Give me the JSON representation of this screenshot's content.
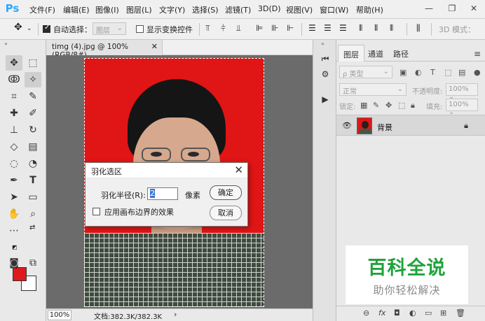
{
  "app": {
    "logo": "Ps"
  },
  "menu": [
    "文件(F)",
    "编辑(E)",
    "图像(I)",
    "图层(L)",
    "文字(Y)",
    "选择(S)",
    "滤镜(T)",
    "3D(D)",
    "视图(V)",
    "窗口(W)",
    "帮助(H)"
  ],
  "options": {
    "auto_select_label": "自动选择：",
    "auto_select_target": "图层",
    "show_transform_label": "显示变换控件",
    "mode_3d": "3D 模式："
  },
  "document": {
    "tab_title": "timg (4).jpg @ 100%(RGB/8#)",
    "zoom": "100%",
    "doc_info": "文档:382.3K/382.3K"
  },
  "colors": {
    "foreground": "#df1a1a",
    "background": "#ffffff",
    "canvas_bg": "#e01515"
  },
  "dialog": {
    "title": "羽化选区",
    "radius_label": "羽化半径(R):",
    "radius_value": "2",
    "unit": "像素",
    "edge_checkbox_label": "应用画布边界的效果",
    "edge_checked": false,
    "ok_label": "确定",
    "cancel_label": "取消"
  },
  "layers_panel": {
    "tabs": [
      "图层",
      "通道",
      "路径"
    ],
    "filter_kind": "ρ 类型",
    "blend_mode": "正常",
    "opacity_label": "不透明度:",
    "opacity_value": "100%",
    "lock_label": "锁定:",
    "fill_label": "填充:",
    "fill_value": "100%",
    "layer_name": "背景"
  },
  "watermark": {
    "title": "百科全说",
    "subtitle": "助你轻松解决"
  }
}
